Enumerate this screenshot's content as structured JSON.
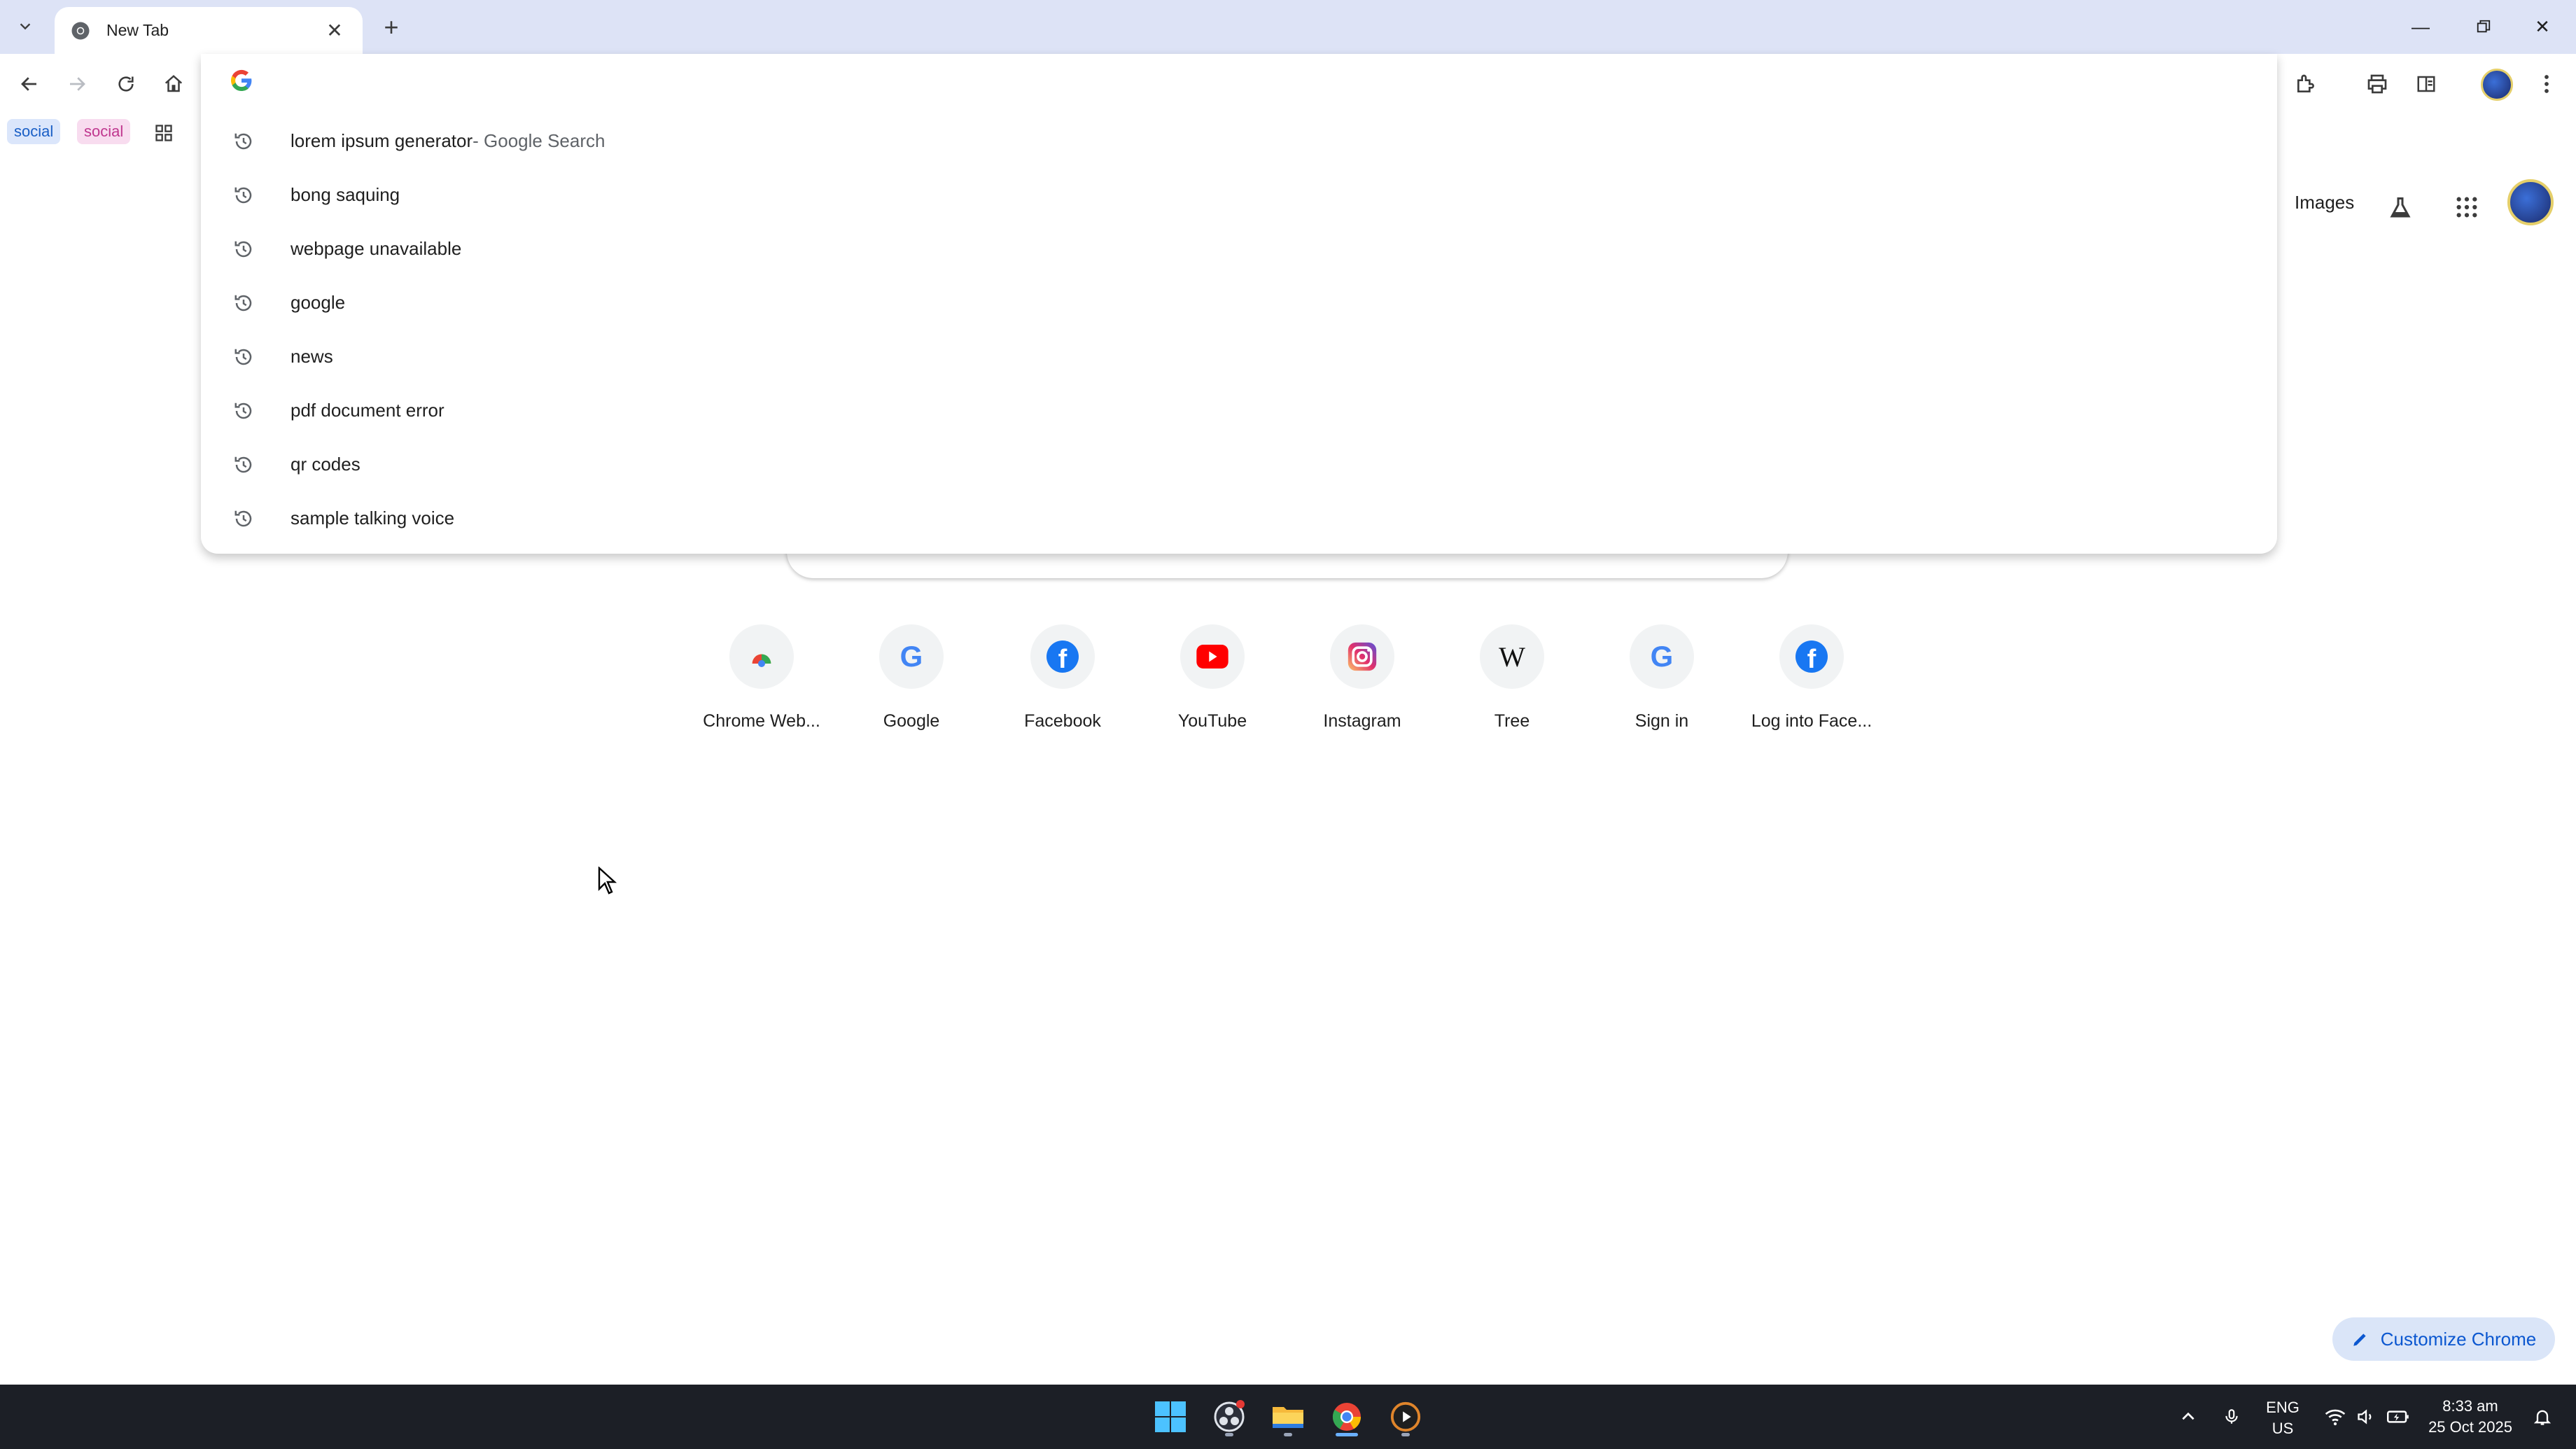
{
  "window": {
    "tab_title": "New Tab",
    "controls": [
      "minimize-icon",
      "restore-icon",
      "close-icon"
    ]
  },
  "bookmarks": [
    {
      "label": "social",
      "color": "#1a5fc6"
    },
    {
      "label": "social",
      "color": "#c0378f"
    }
  ],
  "omnibox": {
    "value": "",
    "suggestions": [
      {
        "text": "lorem ipsum generator",
        "secondary": " - Google Search"
      },
      {
        "text": "bong saquing",
        "secondary": ""
      },
      {
        "text": "webpage unavailable",
        "secondary": ""
      },
      {
        "text": "google",
        "secondary": ""
      },
      {
        "text": "news",
        "secondary": ""
      },
      {
        "text": "pdf document error",
        "secondary": ""
      },
      {
        "text": "qr codes",
        "secondary": ""
      },
      {
        "text": "sample talking voice",
        "secondary": ""
      }
    ]
  },
  "page": {
    "images_link": "Images",
    "shortcuts": [
      {
        "label": "Chrome Web...",
        "icon": "chrome-web-store-icon"
      },
      {
        "label": "Google",
        "icon": "google-icon"
      },
      {
        "label": "Facebook",
        "icon": "facebook-icon"
      },
      {
        "label": "YouTube",
        "icon": "youtube-icon"
      },
      {
        "label": "Instagram",
        "icon": "instagram-icon"
      },
      {
        "label": "Tree",
        "icon": "wikipedia-icon"
      },
      {
        "label": "Sign in",
        "icon": "google-icon"
      },
      {
        "label": "Log into Face...",
        "icon": "facebook-icon"
      }
    ],
    "customize_label": "Customize Chrome"
  },
  "taskbar": {
    "lang_top": "ENG",
    "lang_bottom": "US",
    "time": "8:33 am",
    "date": "25 Oct 2025"
  },
  "colors": {
    "tabstrip": "#dde3f6",
    "accent": "#0b57d0",
    "taskbar": "#1c1f26"
  }
}
